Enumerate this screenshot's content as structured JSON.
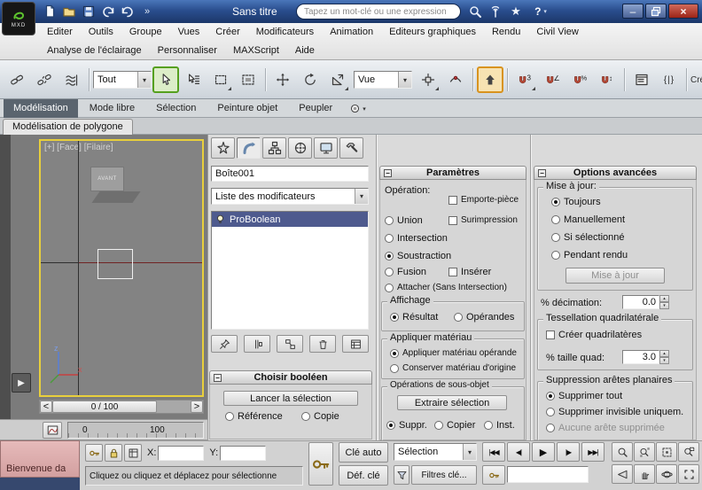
{
  "titlebar": {
    "title": "Sans titre",
    "search_placeholder": "Tapez un mot-clé ou une expression",
    "logo": "MXD",
    "help": "?"
  },
  "menubar": {
    "row1": [
      "Editer",
      "Outils",
      "Groupe",
      "Vues",
      "Créer",
      "Modificateurs",
      "Animation",
      "Editeurs graphiques",
      "Rendu",
      "Civil View"
    ],
    "row2": [
      "Analyse de l'éclairage",
      "Personnaliser",
      "MAXScript",
      "Aide"
    ]
  },
  "toolbar": {
    "selection_filter": "Tout",
    "coord_system": "Vue",
    "truncated_label": "Cré"
  },
  "ribbon": {
    "tabs": [
      "Modélisation",
      "Mode libre",
      "Sélection",
      "Peinture objet",
      "Peupler"
    ],
    "subtab": "Modélisation de polygone"
  },
  "viewport": {
    "label": "[+] [Face] [Filaire]",
    "watermark": "AVANT",
    "axis_x": "x",
    "axis_z": "z"
  },
  "timeline": {
    "prev": "<",
    "handle": "0 / 100",
    "next": ">",
    "ruler_start": "0",
    "ruler_end": "100"
  },
  "command_panel": {
    "object_name": "Boîte001",
    "modifier_list": "Liste des modificateurs",
    "stack_item": "ProBoolean",
    "pick": {
      "title": "Choisir booléen",
      "start_button": "Lancer la sélection",
      "reference": "Référence",
      "copy": "Copie"
    }
  },
  "params": {
    "title": "Paramètres",
    "operation_label": "Opération:",
    "imprint": "Emporte-pièce",
    "cookie": "Surimpression",
    "insert": "Insérer",
    "union": "Union",
    "intersection": "Intersection",
    "subtraction": "Soustraction",
    "merge": "Fusion",
    "attach": "Attacher (Sans Intersection)",
    "display_title": "Affichage",
    "result": "Résultat",
    "operands": "Opérandes",
    "material_title": "Appliquer matériau",
    "material_operand": "Appliquer matériau opérande",
    "material_original": "Conserver matériau d'origine",
    "subobj_title": "Opérations de sous-objet",
    "extract": "Extraire sélection",
    "remove": "Suppr.",
    "copy": "Copier",
    "instance": "Inst."
  },
  "advanced": {
    "title": "Options avancées",
    "update_title": "Mise à jour:",
    "always": "Toujours",
    "manually": "Manuellement",
    "when_selected": "Si sélectionné",
    "during_render": "Pendant rendu",
    "update_button": "Mise à jour",
    "decimation_label": "% décimation:",
    "decimation_value": "0.0",
    "tess_title": "Tessellation quadrilatérale",
    "make_quads": "Créer quadrilatères",
    "quad_label": "% taille quad:",
    "quad_value": "3.0",
    "edge_title": "Suppression arêtes planaires",
    "remove_all": "Supprimer tout",
    "remove_invisible": "Supprimer invisible uniquem.",
    "remove_none": "Aucune arête supprimée"
  },
  "statusbar": {
    "welcome": "Bienvenue da",
    "prompt": "Cliquez ou cliquez et déplacez pour sélectionne",
    "x_label": "X:",
    "y_label": "Y:",
    "auto_key": "Clé auto",
    "set_key": "Déf. clé",
    "selection_set": "Sélection",
    "key_filters": "Filtres clé..."
  },
  "colors": {
    "titlebar_blue": "#27498a",
    "viewport_border": "#e8cf3c",
    "stack_selected": "#4e5a8e",
    "active_tool_green": "#55a01e",
    "override_orange": "#d8931f"
  }
}
